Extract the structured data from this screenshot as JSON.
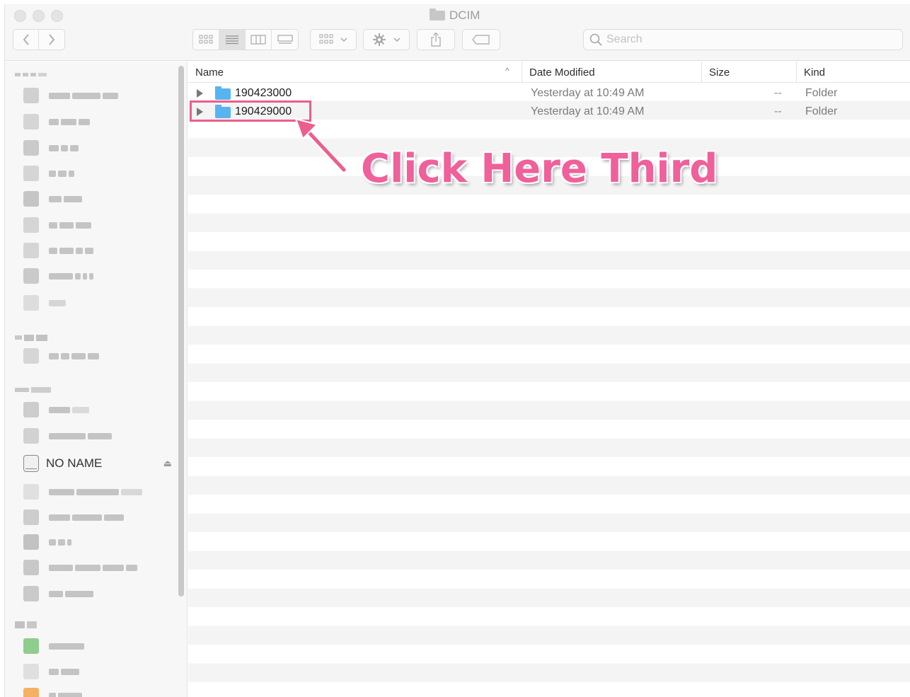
{
  "window": {
    "title": "DCIM",
    "folder_icon": "folder-icon"
  },
  "toolbar": {
    "back_icon": "chevron-left-icon",
    "forward_icon": "chevron-right-icon",
    "view_modes": [
      "icon-view-icon",
      "list-view-icon",
      "column-view-icon",
      "gallery-view-icon"
    ],
    "active_view": "list-view-icon",
    "group_icon": "group-by-icon",
    "action_icon": "gear-icon",
    "share_icon": "share-icon",
    "tag_icon": "tag-icon",
    "search_placeholder": "Search"
  },
  "sidebar": {
    "visible_items": [
      {
        "label": "NO NAME",
        "icon": "external-drive-icon",
        "eject_icon": "eject-icon"
      }
    ]
  },
  "list": {
    "columns": [
      "Name",
      "Date Modified",
      "Size",
      "Kind"
    ],
    "sort_indicator": "^",
    "rows": [
      {
        "name": "190423000",
        "date_modified": "Yesterday at 10:49 AM",
        "size": "--",
        "kind": "Folder"
      },
      {
        "name": "190429000",
        "date_modified": "Yesterday at 10:49 AM",
        "size": "--",
        "kind": "Folder"
      }
    ]
  },
  "annotation": {
    "callout_text": "Click Here Third",
    "color": "#ec5e8d"
  }
}
